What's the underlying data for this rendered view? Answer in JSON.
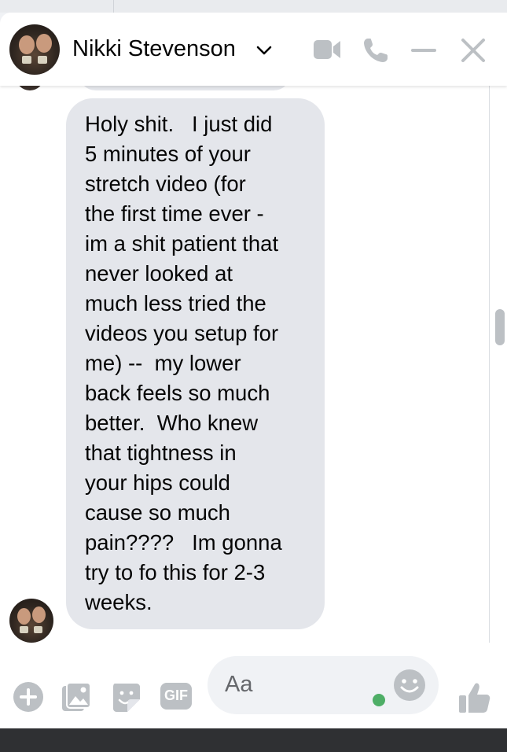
{
  "header": {
    "contact_name": "Nikki Stevenson",
    "avatar_icon": "contact-avatar",
    "dropdown_icon": "chevron-down-icon",
    "actions": [
      {
        "name": "video-call",
        "icon": "video-camera-icon"
      },
      {
        "name": "voice-call",
        "icon": "phone-icon"
      },
      {
        "name": "minimize",
        "icon": "minus-icon"
      },
      {
        "name": "close",
        "icon": "close-icon"
      }
    ]
  },
  "conversation": {
    "message_text": "Holy shit.   I just did 5 minutes of your stretch video (for the first time ever - im a shit patient that never looked at much less tried the videos you setup for me) --  my lower back feels so much better.  Who knew that tightness in your hips could cause so much pain????   Im gonna try to fo this for 2-3 weeks.",
    "message_lines": [
      "Holy shit.   I just did",
      "5 minutes of your",
      "stretch video (for",
      "the first time ever -",
      "im a shit patient that",
      "never looked at",
      "much less tried the",
      "videos you setup for",
      "me) --  my lower",
      "back feels so much",
      "better.  Who knew",
      "that tightness in",
      "your hips could",
      "cause so much",
      "pain????   Im gonna",
      "try to fo this for 2-3",
      "weeks."
    ]
  },
  "composer": {
    "placeholder": "Aa",
    "icons": [
      "plus-circle-icon",
      "photo-icon",
      "sticker-icon",
      "gif-icon",
      "emoji-icon",
      "like-icon"
    ],
    "gif_label": "GIF"
  },
  "colors": {
    "incoming_bubble": "#e4e6eb",
    "outgoing_bubble": "#1877f2",
    "icon_gray": "#bcc0c4",
    "text": "#050505",
    "active_dot": "#31a24c"
  }
}
